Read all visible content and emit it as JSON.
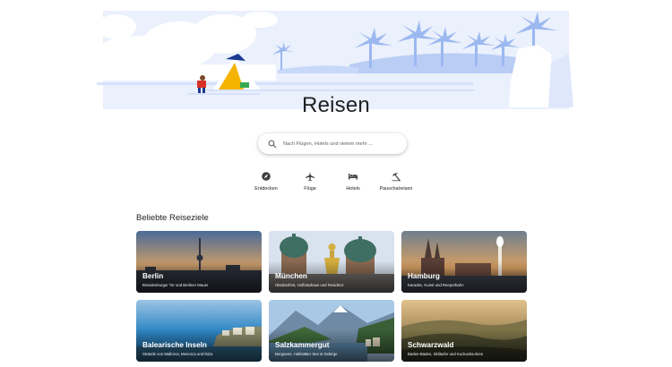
{
  "page": {
    "title": "Reisen"
  },
  "search": {
    "placeholder": "Nach Flügen, Hotels und vielem mehr ...",
    "icon": "search-icon"
  },
  "nav": [
    {
      "label": "Entdecken",
      "icon": "explore-icon"
    },
    {
      "label": "Flüge",
      "icon": "airplane-icon"
    },
    {
      "label": "Hotels",
      "icon": "hotel-bed-icon"
    },
    {
      "label": "Pauschalreisen",
      "icon": "beach-umbrella-icon"
    }
  ],
  "section": {
    "title": "Beliebte Reiseziele"
  },
  "destinations": [
    {
      "name": "Berlin",
      "desc": "Brandenburger Tor und Berliner Mauer"
    },
    {
      "name": "München",
      "desc": "Oktoberfest, Hofbräuhaus und Residenz"
    },
    {
      "name": "Hamburg",
      "desc": "Karaoke, Kunst und Reeperbahn"
    },
    {
      "name": "Balearische Inseln",
      "desc": "Strände von Mallorca, Menorca und Ibiza"
    },
    {
      "name": "Salzkammergut",
      "desc": "Bergseen, Hallstätter See & Gebirge"
    },
    {
      "name": "Schwarzwald",
      "desc": "Baden-Baden, Skiläufer und Kuckucksuhren"
    }
  ],
  "colors": {
    "hero_sky": "#e8eefc",
    "hero_palm": "#9bb8f0",
    "accent": "#1a73e8"
  }
}
